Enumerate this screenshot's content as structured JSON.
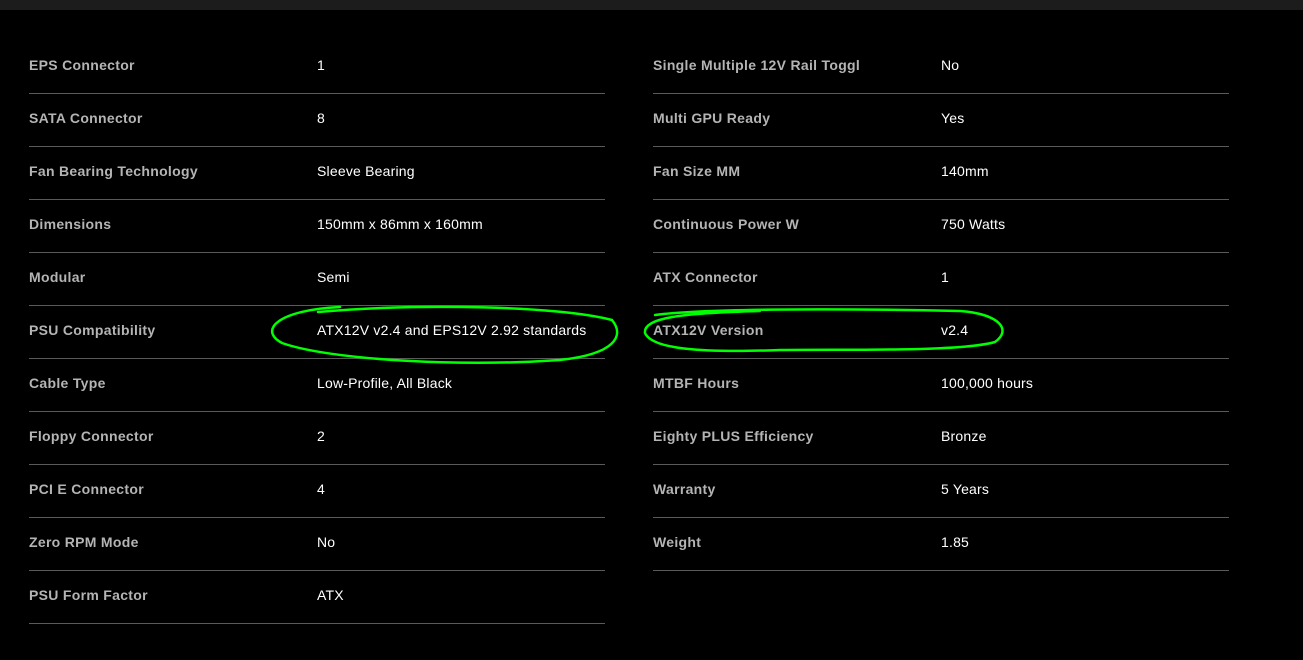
{
  "annotation_color": "#00ff00",
  "left_specs": [
    {
      "label": "EPS Connector",
      "value": "1"
    },
    {
      "label": "SATA Connector",
      "value": "8"
    },
    {
      "label": "Fan Bearing Technology",
      "value": "Sleeve Bearing"
    },
    {
      "label": "Dimensions",
      "value": "150mm x 86mm x 160mm"
    },
    {
      "label": "Modular",
      "value": "Semi"
    },
    {
      "label": "PSU Compatibility",
      "value": "ATX12V v2.4 and EPS12V 2.92 standards"
    },
    {
      "label": "Cable Type",
      "value": "Low-Profile, All Black"
    },
    {
      "label": "Floppy Connector",
      "value": "2"
    },
    {
      "label": "PCI E Connector",
      "value": "4"
    },
    {
      "label": "Zero RPM Mode",
      "value": "No"
    },
    {
      "label": "PSU Form Factor",
      "value": "ATX"
    }
  ],
  "right_specs": [
    {
      "label": "Single Multiple 12V Rail Toggl",
      "value": "No"
    },
    {
      "label": "Multi GPU Ready",
      "value": "Yes"
    },
    {
      "label": "Fan Size MM",
      "value": "140mm"
    },
    {
      "label": "Continuous Power W",
      "value": "750 Watts"
    },
    {
      "label": "ATX Connector",
      "value": "1"
    },
    {
      "label": "ATX12V Version",
      "value": "v2.4"
    },
    {
      "label": "MTBF Hours",
      "value": "100,000 hours"
    },
    {
      "label": "Eighty PLUS Efficiency",
      "value": "Bronze"
    },
    {
      "label": "Warranty",
      "value": "5 Years"
    },
    {
      "label": "Weight",
      "value": "1.85"
    }
  ]
}
